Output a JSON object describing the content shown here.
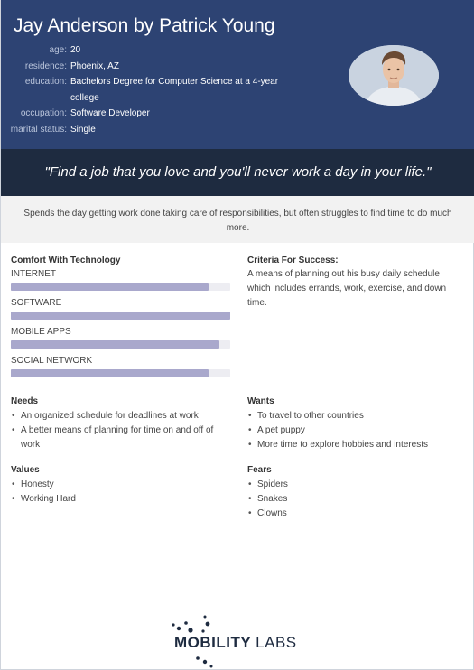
{
  "header": {
    "title": "Jay Anderson by Patrick Young",
    "info": [
      {
        "key": "age:",
        "value": "20"
      },
      {
        "key": "residence:",
        "value": "Phoenix, AZ"
      },
      {
        "key": "education:",
        "value": "Bachelors Degree for Computer Science at a 4-year college"
      },
      {
        "key": "occupation:",
        "value": "Software Developer"
      },
      {
        "key": "marital status:",
        "value": "Single"
      }
    ]
  },
  "quote": "\"Find a job that you love and you'll never work a day in your life.\"",
  "summary": "Spends the day getting work done taking care of responsibilities, but often struggles to find time to do much more.",
  "tech": {
    "title": "Comfort With Technology",
    "items": [
      {
        "label": "INTERNET",
        "level": 0.9
      },
      {
        "label": "SOFTWARE",
        "level": 1.0
      },
      {
        "label": "MOBILE APPS",
        "level": 0.95
      },
      {
        "label": "SOCIAL NETWORK",
        "level": 0.9
      }
    ]
  },
  "criteria": {
    "title": "Criteria For Success:",
    "text": "A means of planning out his busy daily schedule which includes errands, work, exercise, and down time."
  },
  "needs": {
    "title": "Needs",
    "items": [
      "An organized schedule for deadlines at work",
      "A better means of planning for time on and off of work"
    ]
  },
  "wants": {
    "title": "Wants",
    "items": [
      "To travel to other countries",
      "A pet puppy",
      "More time to explore hobbies and interests"
    ]
  },
  "values": {
    "title": "Values",
    "items": [
      "Honesty",
      "Working Hard"
    ]
  },
  "fears": {
    "title": "Fears",
    "items": [
      "Spiders",
      "Snakes",
      "Clowns"
    ]
  },
  "logo": {
    "bold": "MOBILITY",
    "light": "LABS"
  },
  "colors": {
    "header_bg": "#2d4373",
    "quote_bg": "#1e2b40",
    "bar_fill": "#a9a8cc"
  }
}
